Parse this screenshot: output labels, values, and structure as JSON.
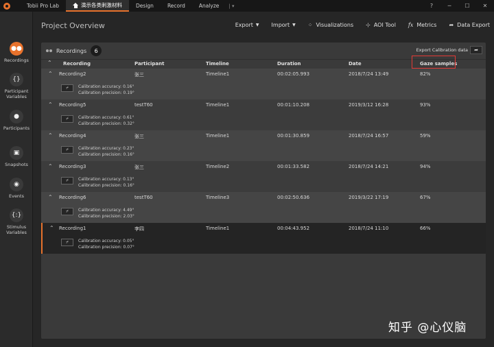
{
  "titlebar": {
    "app_name": "Tobii Pro Lab",
    "project_tab": "演示各类刺激材料",
    "tabs": [
      "Design",
      "Record",
      "Analyze"
    ],
    "window_controls": [
      "?",
      "─",
      "☐",
      "✕"
    ]
  },
  "sidebar": {
    "items": [
      {
        "label": "Recordings",
        "icon": "recordings-icon"
      },
      {
        "label": "Participant Variables",
        "icon": "participant-variables-icon"
      },
      {
        "label": "Participants",
        "icon": "participants-icon"
      },
      {
        "label": "Snapshots",
        "icon": "snapshots-icon"
      },
      {
        "label": "Events",
        "icon": "events-icon"
      },
      {
        "label": "Stimulus Variables",
        "icon": "stimulus-variables-icon"
      }
    ]
  },
  "header": {
    "title": "Project Overview",
    "toolbar": {
      "export": "Export",
      "import": "Import",
      "visualizations": "Visualizations",
      "aoi_tool": "AOI Tool",
      "metrics": "Metrics",
      "data_export": "Data Export"
    }
  },
  "panel": {
    "title": "Recordings",
    "count": "6",
    "export_calibration": "Export Calibration data",
    "columns": [
      "Recording",
      "Participant",
      "Timeline",
      "Duration",
      "Date",
      "Gaze samples"
    ],
    "rows": [
      {
        "recording": "Recording2",
        "participant": "张三",
        "timeline": "Timeline1",
        "duration": "00:02:05.993",
        "date": "2018/7/24 13:49",
        "gaze": "82%",
        "accuracy": "Calibration accuracy: 0.16°",
        "precision": "Calibration precision: 0.19°"
      },
      {
        "recording": "Recording5",
        "participant": "testT60",
        "timeline": "Timeline1",
        "duration": "00:01:10.208",
        "date": "2019/3/12 16:28",
        "gaze": "93%",
        "accuracy": "Calibration accuracy: 0.61°",
        "precision": "Calibration precision: 0.32°"
      },
      {
        "recording": "Recording4",
        "participant": "张三",
        "timeline": "Timeline1",
        "duration": "00:01:30.859",
        "date": "2018/7/24 16:57",
        "gaze": "59%",
        "accuracy": "Calibration accuracy: 0.23°",
        "precision": "Calibration precision: 0.16°"
      },
      {
        "recording": "Recording3",
        "participant": "张三",
        "timeline": "Timeline2",
        "duration": "00:01:33.582",
        "date": "2018/7/24 14:21",
        "gaze": "94%",
        "accuracy": "Calibration accuracy: 0.13°",
        "precision": "Calibration precision: 0.16°"
      },
      {
        "recording": "Recording6",
        "participant": "testT60",
        "timeline": "Timeline3",
        "duration": "00:02:50.636",
        "date": "2019/3/22 17:19",
        "gaze": "67%",
        "accuracy": "Calibration accuracy: 4.49°",
        "precision": "Calibration precision: 2.03°"
      },
      {
        "recording": "Recording1",
        "participant": "李四",
        "timeline": "Timeline1",
        "duration": "00:04:43.952",
        "date": "2018/7/24 11:10",
        "gaze": "66%",
        "accuracy": "Calibration accuracy: 0.05°",
        "precision": "Calibration precision: 0.07°"
      }
    ]
  },
  "watermark": "知乎 @心仪脑",
  "colors": {
    "accent": "#e8722c",
    "highlight": "#e53935"
  }
}
